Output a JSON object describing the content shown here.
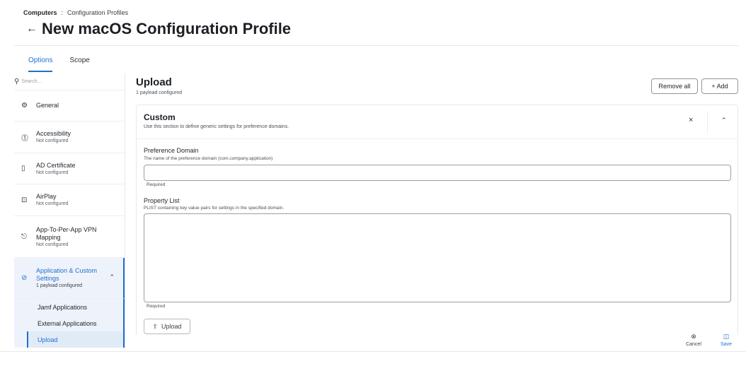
{
  "breadcrumb": {
    "root": "Computers",
    "separator": ":",
    "current": "Configuration Profiles"
  },
  "page": {
    "back_icon": "←",
    "title": "New macOS Configuration Profile"
  },
  "tabs": [
    {
      "label": "Options",
      "active": true
    },
    {
      "label": "Scope",
      "active": false
    }
  ],
  "sidebar": {
    "search_placeholder": "Search...",
    "items": [
      {
        "icon": "gear-icon",
        "glyph": "⚙",
        "label": "General",
        "sub": ""
      },
      {
        "icon": "accessibility-icon",
        "glyph": "⓵",
        "label": "Accessibility",
        "sub": "Not configured"
      },
      {
        "icon": "certificate-icon",
        "glyph": "▯",
        "label": "AD Certificate",
        "sub": "Not configured"
      },
      {
        "icon": "airplay-icon",
        "glyph": "⊡",
        "label": "AirPlay",
        "sub": "Not configured"
      },
      {
        "icon": "lock-icon",
        "glyph": "🔒",
        "label": "App-To-Per-App VPN Mapping",
        "sub": "Not configured"
      },
      {
        "icon": "block-icon",
        "glyph": "⊘",
        "label": "Application & Custom Settings",
        "sub": "1 payload configured"
      }
    ],
    "sub_items": [
      {
        "label": "Jamf Applications"
      },
      {
        "label": "External Applications"
      },
      {
        "label": "Upload"
      }
    ]
  },
  "content": {
    "title": "Upload",
    "subtitle": "1 payload configured",
    "remove_all_label": "Remove all",
    "add_label": "+ Add"
  },
  "card": {
    "title": "Custom",
    "description": "Use this section to define generic settings for preference domains.",
    "close_glyph": "×",
    "collapse_glyph": "⌃"
  },
  "fields": {
    "domain": {
      "label": "Preference Domain",
      "help": "The name of the preference domain (com.company.application)",
      "value": "",
      "required": "Required"
    },
    "plist": {
      "label": "Property List",
      "help": "PLIST containing key value pairs for settings in the specified domain.",
      "value": "",
      "required": "Required"
    },
    "upload_label": "Upload",
    "upload_glyph": "⇧"
  },
  "footer": {
    "cancel_label": "Cancel",
    "cancel_glyph": "⊗",
    "save_label": "Save",
    "save_glyph": "💾"
  },
  "colors": {
    "accent": "#1f6fd1",
    "selected_bg": "#eef3fb"
  }
}
